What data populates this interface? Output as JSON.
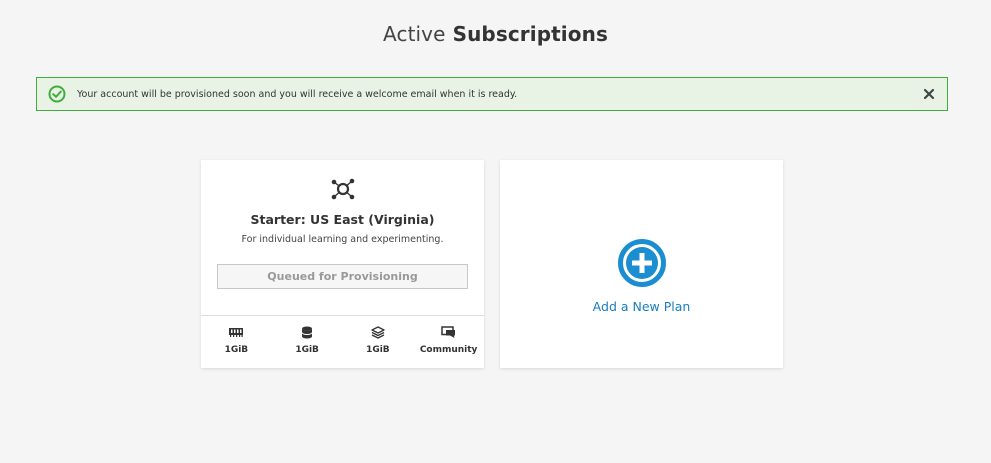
{
  "header": {
    "title_light": "Active",
    "title_bold": "Subscriptions"
  },
  "alert": {
    "message": "Your account will be provisioned soon and you will receive a welcome email when it is ready.",
    "icon": "check-circle-icon",
    "close_icon": "close-icon",
    "border_color": "#3fae3b",
    "background_color": "#e8f3e6"
  },
  "plan": {
    "icon": "cluster-icon",
    "name": "Starter: US East (Virginia)",
    "description": "For individual learning and experimenting.",
    "status": "Queued for Provisioning",
    "specs": [
      {
        "icon": "memory-icon",
        "value": "1GiB"
      },
      {
        "icon": "database-icon",
        "value": "1GiB"
      },
      {
        "icon": "layers-icon",
        "value": "1GiB"
      },
      {
        "icon": "chat-icon",
        "value": "Community"
      }
    ]
  },
  "add_plan": {
    "label": "Add a New Plan",
    "icon": "plus-circle-icon",
    "accent_color": "#1a8ed0"
  }
}
